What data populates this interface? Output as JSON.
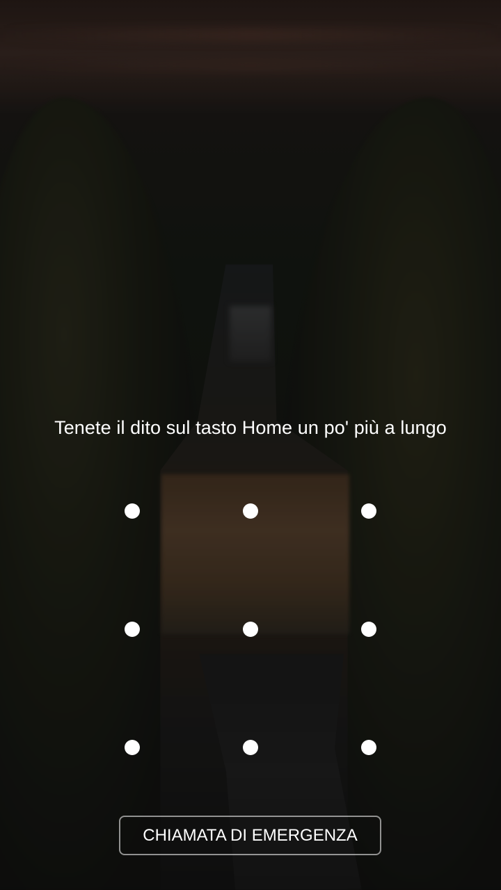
{
  "lock_screen": {
    "hint_text": "Tenete il dito sul tasto Home un po' più a lungo",
    "pattern_dots": [
      {
        "id": "1"
      },
      {
        "id": "2"
      },
      {
        "id": "3"
      },
      {
        "id": "4"
      },
      {
        "id": "5"
      },
      {
        "id": "6"
      },
      {
        "id": "7"
      },
      {
        "id": "8"
      },
      {
        "id": "9"
      }
    ],
    "emergency_label": "CHIAMATA DI EMERGENZA"
  },
  "colors": {
    "text": "#ffffff",
    "dot": "#ffffff",
    "button_border": "#ffffff"
  }
}
